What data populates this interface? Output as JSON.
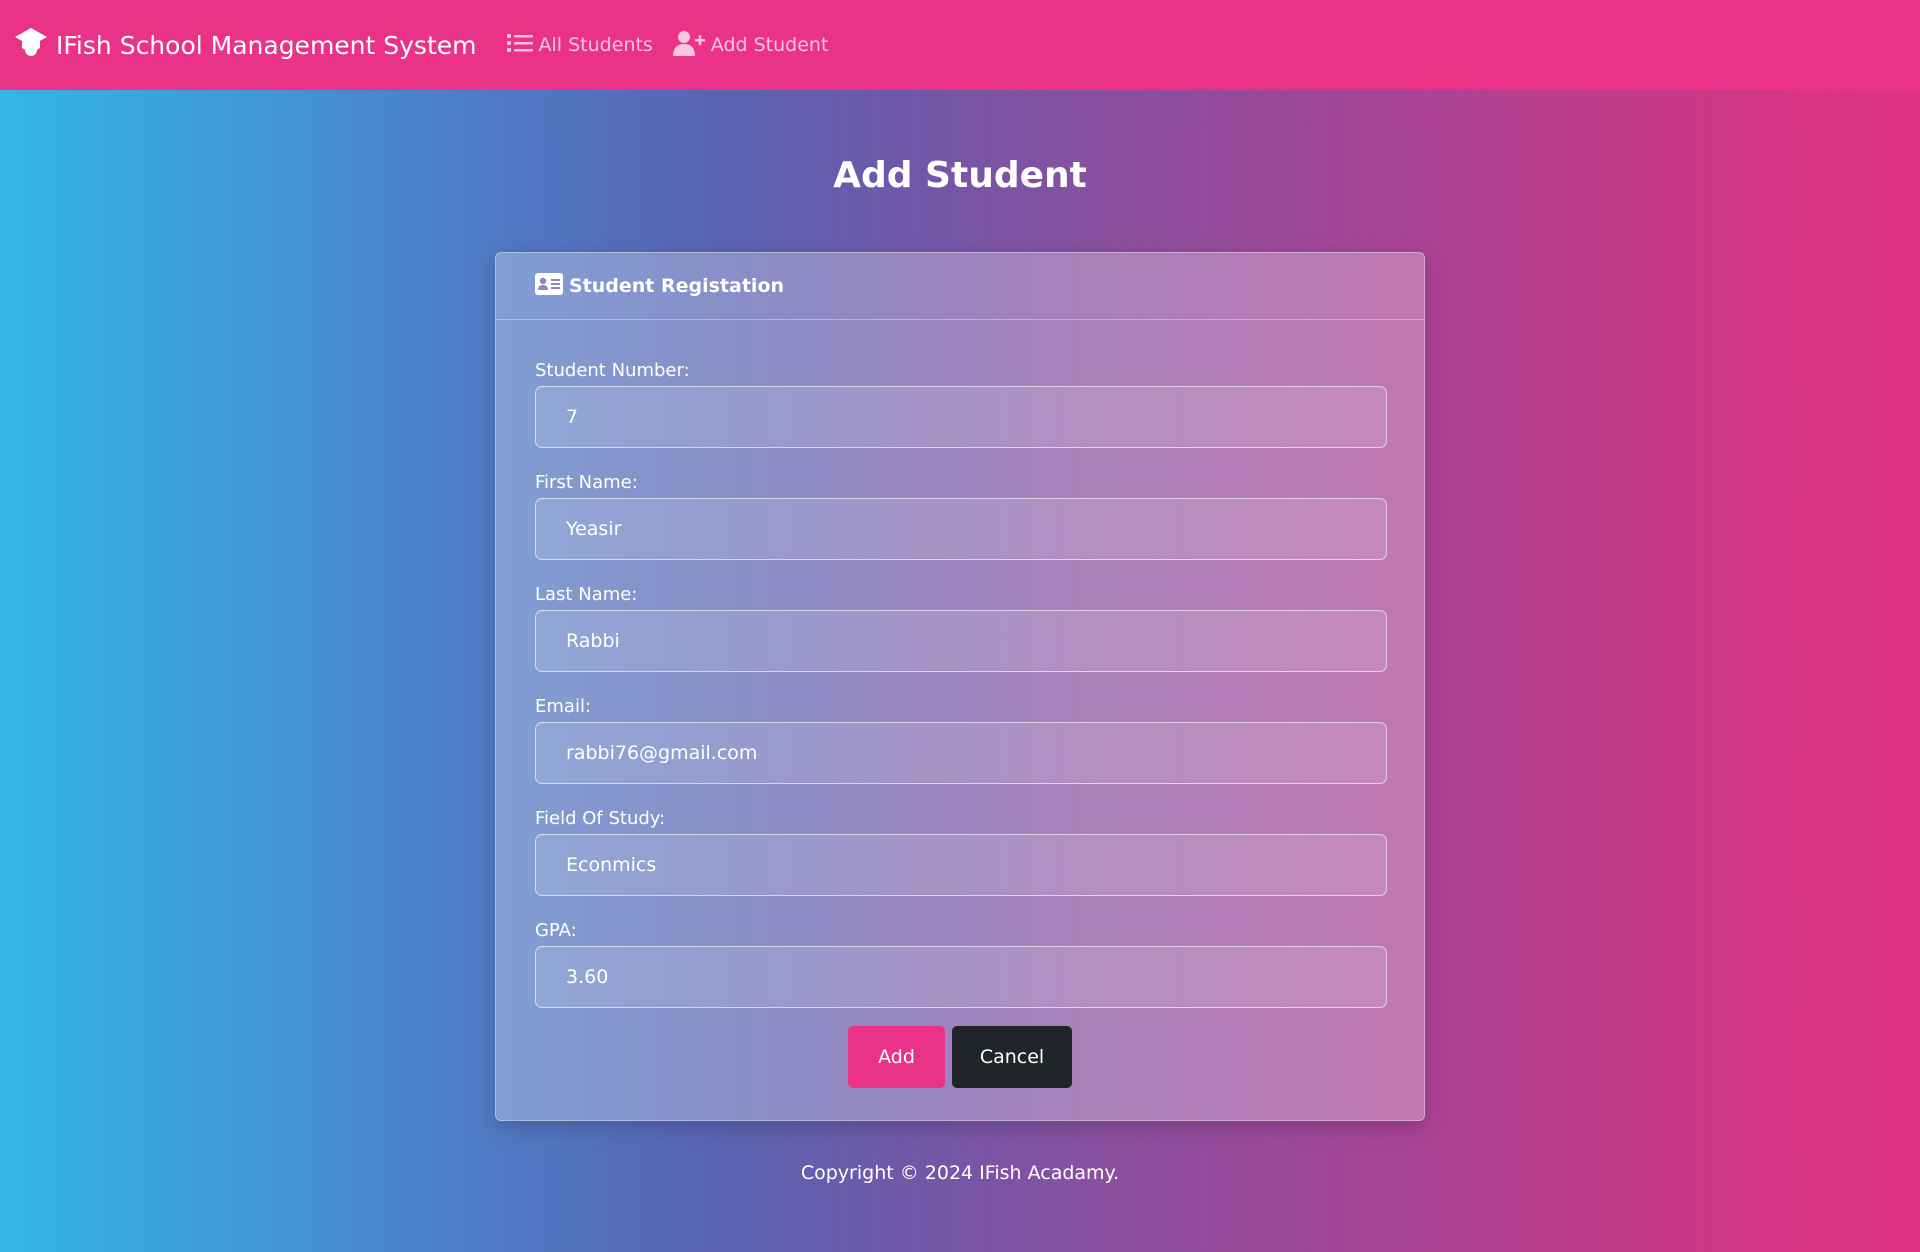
{
  "nav": {
    "brand": "IFish School Management System",
    "links": [
      {
        "label": "All Students",
        "icon": "list-icon"
      },
      {
        "label": "Add Student",
        "icon": "user-plus-icon"
      }
    ]
  },
  "page": {
    "title": "Add Student"
  },
  "form": {
    "header": "Student Registation",
    "fields": [
      {
        "label": "Student Number:",
        "value": "7"
      },
      {
        "label": "First Name:",
        "value": "Yeasir"
      },
      {
        "label": "Last Name:",
        "value": "Rabbi"
      },
      {
        "label": "Email:",
        "value": "rabbi76@gmail.com"
      },
      {
        "label": "Field Of Study:",
        "value": "Econmics"
      },
      {
        "label": "GPA:",
        "value": "3.60"
      }
    ],
    "add_label": "Add",
    "cancel_label": "Cancel"
  },
  "footer": {
    "text": "Copyright © 2024 IFish Acadamy."
  },
  "colors": {
    "navbar": "#ea3287",
    "add_button": "#ea3287",
    "cancel_button": "#212529"
  }
}
